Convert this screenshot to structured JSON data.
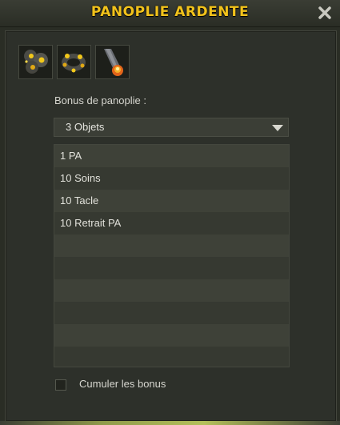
{
  "window": {
    "title": "PANOPLIE ARDENTE",
    "title_color": "#f1c21b"
  },
  "items": [
    {
      "icon": "ardent-amulet-icon"
    },
    {
      "icon": "ardent-belt-icon"
    },
    {
      "icon": "ardent-torch-weapon-icon"
    }
  ],
  "bonus": {
    "label": "Bonus de panoplie :",
    "selected": "3 Objets",
    "rows": [
      "1 PA",
      "10 Soins",
      "10 Tacle",
      "10 Retrait PA",
      "",
      "",
      "",
      "",
      "",
      ""
    ]
  },
  "cumulate": {
    "label": "Cumuler les bonus",
    "checked": false
  }
}
